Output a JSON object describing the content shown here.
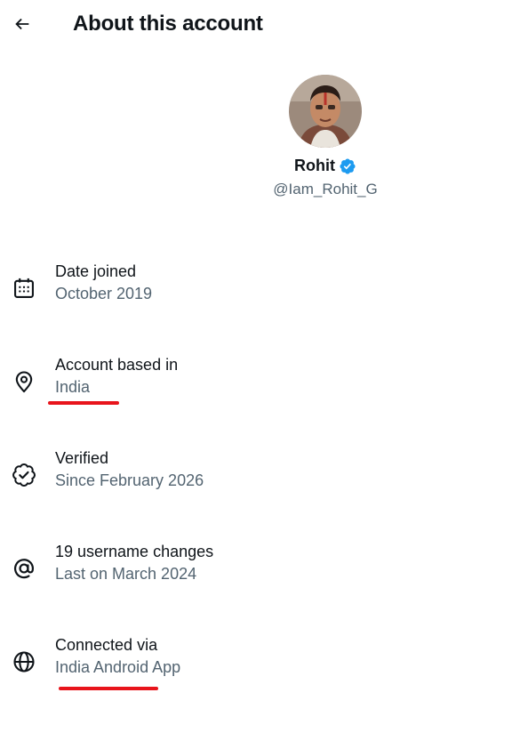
{
  "header": {
    "title": "About this account",
    "back_icon": "arrow-left-icon"
  },
  "profile": {
    "display_name": "Rohit",
    "handle": "@Iam_Rohit_G",
    "verified_badge_color": "#1d9bf0"
  },
  "details": [
    {
      "icon": "calendar-icon",
      "label": "Date joined",
      "value": "October 2019"
    },
    {
      "icon": "location-pin-icon",
      "label": "Account based in",
      "value": "India"
    },
    {
      "icon": "verified-check-icon",
      "label": "Verified",
      "value": "Since February 2026"
    },
    {
      "icon": "at-sign-icon",
      "label": "19 username changes",
      "value": "Last on March 2024"
    },
    {
      "icon": "globe-icon",
      "label": "Connected via",
      "value": "India Android App"
    }
  ],
  "colors": {
    "text_primary": "#0f1419",
    "text_secondary": "#536471",
    "annotation_underline": "#e8141b"
  }
}
